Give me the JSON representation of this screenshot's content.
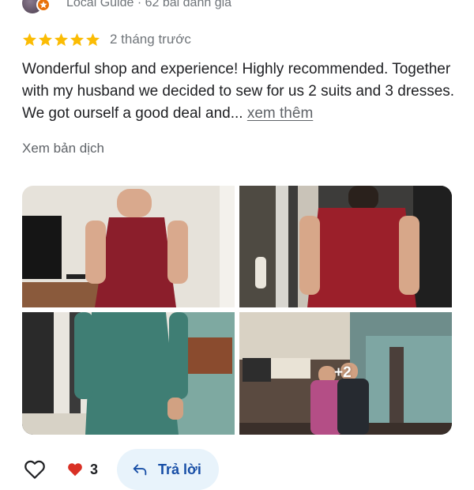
{
  "reviewer": {
    "meta": "Local Guide · 62 bài đánh giá"
  },
  "rating": {
    "stars": 5,
    "max": 5,
    "time_ago": "2 tháng trước"
  },
  "review": {
    "text": "Wonderful shop and experience! Highly recommended. Together with my husband we decided to sew for us 2 suits and 3 dresses. We got ourself a good deal and...",
    "more_label": "xem thêm"
  },
  "translate_label": "Xem bản dịch",
  "photos": {
    "extra_count_label": "+2"
  },
  "actions": {
    "reaction_count": "3",
    "reply_label": "Trả lời"
  },
  "colors": {
    "star": "#fbbc04",
    "badge": "#e8710a",
    "reply_bg": "#e8f3fb",
    "reply_text": "#174ea6",
    "heart": "#d93025"
  }
}
